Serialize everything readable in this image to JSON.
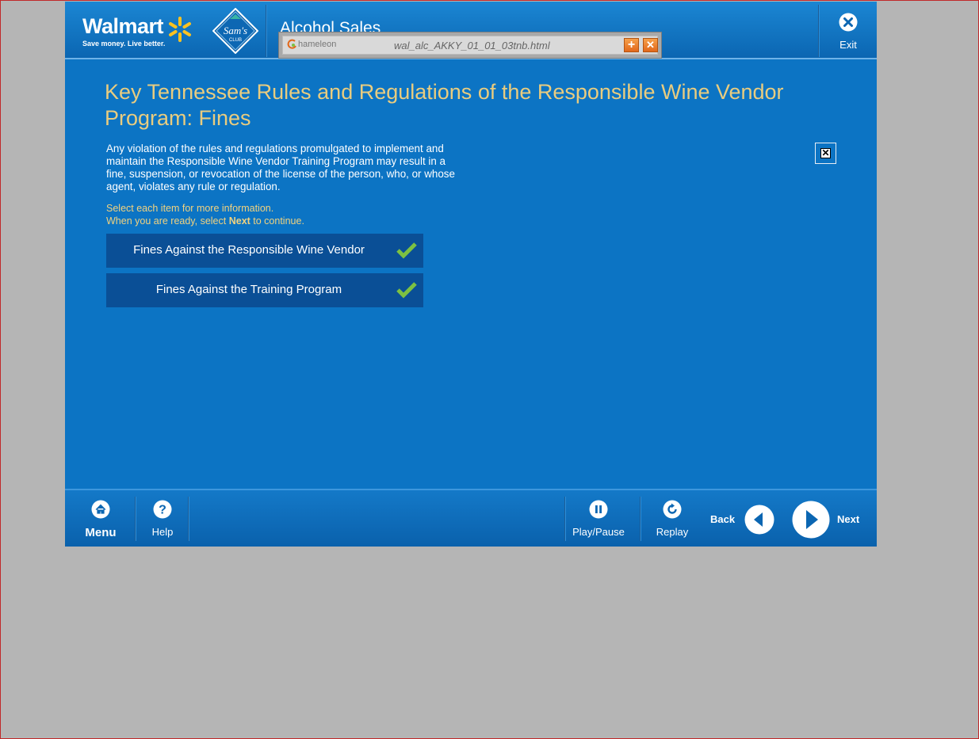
{
  "header": {
    "brand": "Walmart",
    "tagline": "Save money. Live better.",
    "sams_brand": "Sam's",
    "sams_sub": "CLUB",
    "course_title": "Alcohol Sales",
    "exit_label": "Exit"
  },
  "overlay": {
    "logo_text": "hameleon",
    "file_name": "wal_alc_AKKY_01_01_03tnb.html",
    "plus_symbol": "+",
    "close_symbol": "✕"
  },
  "content": {
    "title": "Key Tennessee Rules and Regulations of the Responsible Wine Vendor Program:  Fines",
    "body": "Any violation of the rules and regulations promulgated to implement and maintain the Responsible Wine Vendor Training Program may result in a fine, suspension, or revocation of the license of the person, who, or whose agent, violates any rule or regulation.",
    "instruction_line1": "Select each item for more information.",
    "instruction_line2_pre": "When you are ready, select ",
    "instruction_line2_bold": "Next",
    "instruction_line2_post": " to continue.",
    "items": [
      {
        "label": "Fines Against the Responsible Wine Vendor",
        "completed": true
      },
      {
        "label": "Fines Against the Training Program",
        "completed": true
      }
    ],
    "close_symbol": "✕"
  },
  "footer": {
    "menu_label": "Menu",
    "help_label": "Help",
    "play_pause_label": "Play/Pause",
    "replay_label": "Replay",
    "back_label": "Back",
    "next_label": "Next"
  },
  "colors": {
    "app_bg": "#0c74c4",
    "title_gold": "#e9cc7f",
    "button_bg": "#0a4f96",
    "check_green": "#7cc142",
    "page_bg": "#b5b5b5"
  }
}
